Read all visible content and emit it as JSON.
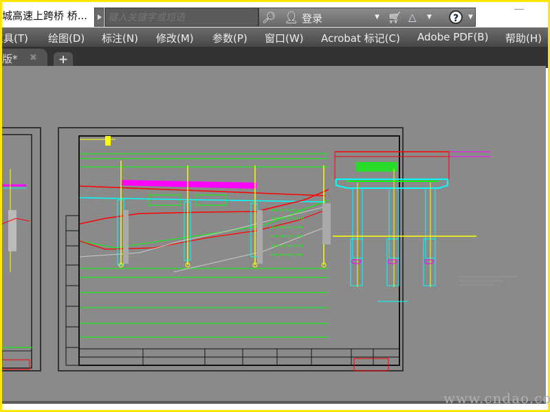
{
  "titlebar": {
    "document_title": "城高速上跨桥 桥...",
    "search_placeholder": "键入关键字或短语",
    "login_label": "登录"
  },
  "icons": {
    "binoculars": "binoculars-icon",
    "user": "user-icon",
    "cart": "cart-icon",
    "autodesk_360": "a360-icon",
    "help": "help-icon"
  },
  "menu": {
    "items": [
      {
        "label": "工具(T)"
      },
      {
        "label": "绘图(D)"
      },
      {
        "label": "标注(N)"
      },
      {
        "label": "修改(M)"
      },
      {
        "label": "参数(P)"
      },
      {
        "label": "窗口(W)"
      },
      {
        "label": "Acrobat 标记(C)"
      },
      {
        "label": "Adobe PDF(B)"
      },
      {
        "label": "帮助(H)"
      }
    ]
  },
  "tabs": {
    "active_label": "改版*",
    "add_label": "+"
  },
  "watermark": "www.cndao.com",
  "colors": {
    "frame_border": "#ffe800",
    "canvas_bg": "#8a8a8a",
    "cad_green": "#00ff00",
    "cad_red": "#ff0000",
    "cad_cyan": "#00ffff",
    "cad_magenta": "#ff00ff",
    "cad_yellow": "#ffff00"
  }
}
